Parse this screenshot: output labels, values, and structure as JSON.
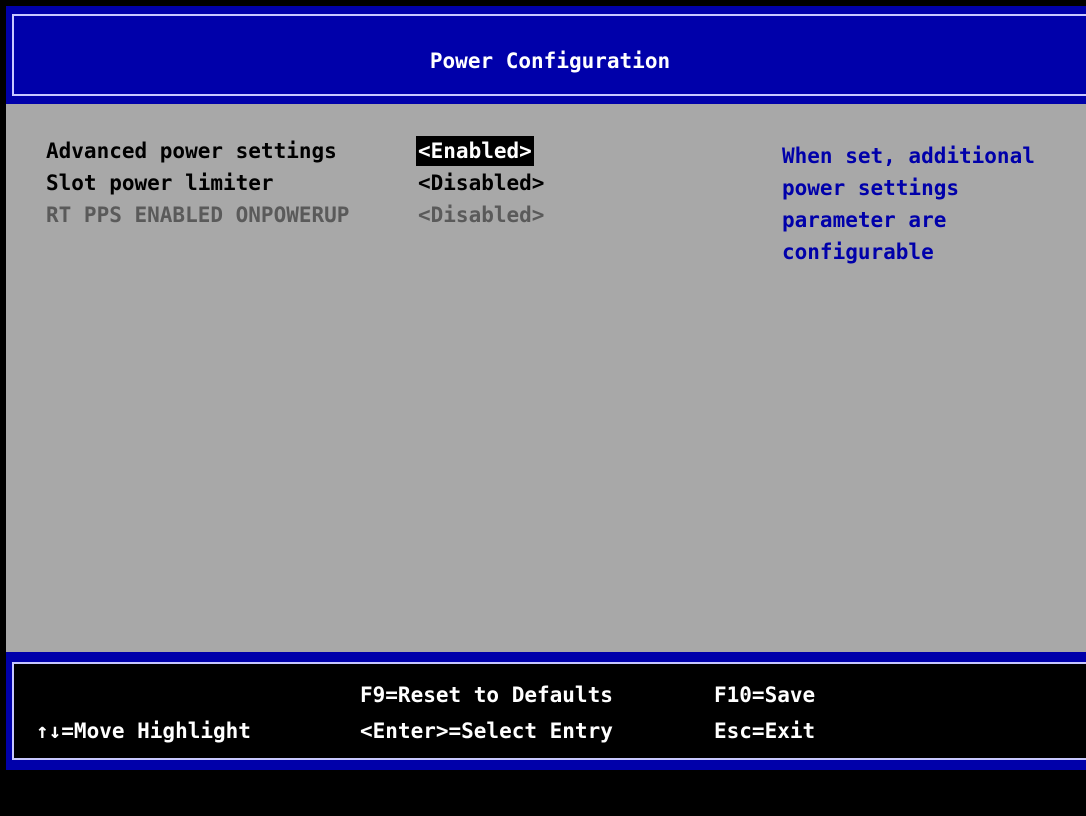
{
  "header": {
    "title": "Power Configuration"
  },
  "settings": [
    {
      "label": "Advanced power settings",
      "value": "<Enabled>",
      "selected": true,
      "enabled": true
    },
    {
      "label": "Slot power limiter",
      "value": "<Disabled>",
      "selected": false,
      "enabled": true
    },
    {
      "label": "RT PPS ENABLED ONPOWERUP",
      "value": "<Disabled>",
      "selected": false,
      "enabled": false
    }
  ],
  "help": {
    "lines": [
      "When set, additional",
      "power settings",
      "parameter are",
      "configurable"
    ]
  },
  "footer": {
    "move_highlight": "↑↓=Move Highlight",
    "reset_defaults": "F9=Reset to Defaults",
    "select_entry": "<Enter>=Select Entry",
    "save": "F10=Save",
    "exit": "Esc=Exit"
  },
  "colors": {
    "header_bg": "#0000aa",
    "panel_bg": "#a8a8a8",
    "help_text": "#0000aa",
    "disabled_text": "#5a5a5a",
    "selected_bg": "#000000"
  }
}
